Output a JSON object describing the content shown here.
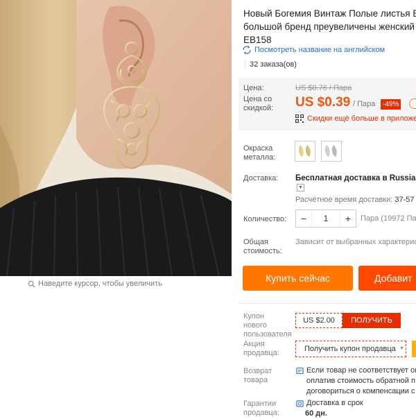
{
  "image": {
    "zoom_hint": "Наведите курсор, чтобы увеличить"
  },
  "product": {
    "title": "Новый Богемия Винтаж Полые листья В большой бренд преувеличены женский EB158",
    "translate_link": "Посмотреть название на английском",
    "orders": "32 заказа(ов)"
  },
  "price": {
    "price_label": "Цена:",
    "discount_label": "Цена со скидкой:",
    "old_price": "US $0.76 / Пара",
    "new_price": "US $0.39",
    "unit": "/ Пара",
    "discount": "-49%",
    "app_promo": "Скидки ещё больше в приложе"
  },
  "options": {
    "color_label": "Окраска металла:",
    "shipping_label": "Доставка:",
    "shipping_value": "Бесплатная доставка в Russian F",
    "delivery_time": "Расчётное время доставки:",
    "delivery_days": "37-57",
    "quantity_label": "Количество:",
    "quantity_value": "1",
    "quantity_minus": "−",
    "quantity_plus": "+",
    "quantity_note": "Пара (19972 Па",
    "total_label": "Общая стоимость:",
    "total_note": "Зависит от выбранных характерис"
  },
  "actions": {
    "buy_now": "Купить сейчас",
    "add_to_cart": "Добавит"
  },
  "promotions": {
    "new_user_label": "Купон нового пользователя",
    "coupon_value": "US $2.00",
    "coupon_get": "ПОЛУЧИТЬ",
    "seller_promo_label": "Акция продавца:",
    "seller_coupon": "Получить купон продавца",
    "return_label": "Возврат товара",
    "return_line1": "Если товар не соответствует оп",
    "return_line2": "оплатив стоимость обратной п",
    "return_line3": "договориться о компенсации с",
    "guarantee_label": "Гарантии продавца:",
    "guarantee_line1": "Доставка в срок",
    "guarantee_line2": "60 дн."
  },
  "colors": {
    "accent": "#ff7700",
    "price": "#f0560f",
    "link": "#2a6bcc",
    "sale": "#e62e04"
  }
}
